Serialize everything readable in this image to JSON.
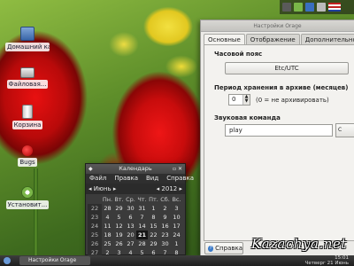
{
  "desktop": {
    "icons": [
      {
        "label": "Домашний каталог",
        "icon": "home-folder-icon"
      },
      {
        "label": "Файловая...",
        "icon": "file-system-icon"
      },
      {
        "label": "Корзина",
        "icon": "trash-icon"
      },
      {
        "label": "Bugs",
        "icon": "ladybug-icon"
      },
      {
        "label": "Установит...",
        "icon": "installer-icon"
      }
    ]
  },
  "settings_window": {
    "title": "Настройки Orage",
    "tabs": [
      "Основные",
      "Отображение",
      "Дополнительно"
    ],
    "timezone": {
      "heading": "Часовой пояс",
      "value": "Etc/UTC"
    },
    "archive": {
      "heading": "Период хранения в архиве (месяцев)",
      "value": "0",
      "hint": "(0 = не архивировать)"
    },
    "sound": {
      "heading": "Звуковая команда",
      "value": "play",
      "button": "C"
    },
    "help_button": "Справка"
  },
  "calendar": {
    "title": "Календарь",
    "menu": [
      "Файл",
      "Правка",
      "Вид",
      "Справка"
    ],
    "month": "Июнь",
    "year": "2012",
    "weekdays": [
      "Пн.",
      "Вт.",
      "Ср.",
      "Чт.",
      "Пт.",
      "Сб.",
      "Вс."
    ],
    "weeks": [
      {
        "wk": "22",
        "days": [
          "28",
          "29",
          "30",
          "31",
          "1",
          "2",
          "3"
        ]
      },
      {
        "wk": "23",
        "days": [
          "4",
          "5",
          "6",
          "7",
          "8",
          "9",
          "10"
        ]
      },
      {
        "wk": "24",
        "days": [
          "11",
          "12",
          "13",
          "14",
          "15",
          "16",
          "17"
        ]
      },
      {
        "wk": "25",
        "days": [
          "18",
          "19",
          "20",
          "21",
          "22",
          "23",
          "24"
        ]
      },
      {
        "wk": "26",
        "days": [
          "25",
          "26",
          "27",
          "28",
          "29",
          "30",
          "1"
        ]
      },
      {
        "wk": "27",
        "days": [
          "2",
          "3",
          "4",
          "5",
          "6",
          "7",
          "8"
        ]
      }
    ],
    "today": "21"
  },
  "taskbar": {
    "task_label": "Настройки Orage",
    "time": "15:01",
    "date": "Четверг 21 Июнь"
  },
  "watermark": "Kazachya.net",
  "colors": {
    "accent_red": "#d81010",
    "panel_bg": "#ecebe8",
    "calendar_bg": "#3b3b3b"
  }
}
